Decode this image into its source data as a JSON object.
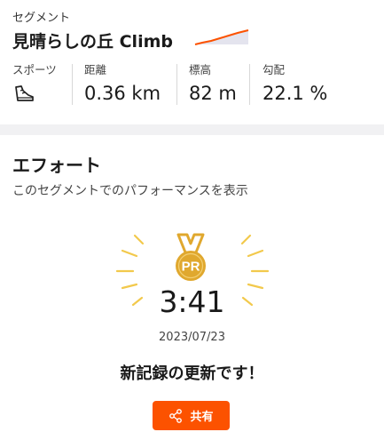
{
  "segment": {
    "section_label": "セグメント",
    "title": "見晴らしの丘 Climb",
    "sparkline_color": "#fc5200"
  },
  "stats": {
    "sport": {
      "label": "スポーツ",
      "icon": "running-shoe-icon"
    },
    "distance": {
      "label": "距離",
      "value": "0.36 km"
    },
    "elevation": {
      "label": "標高",
      "value": "82 m"
    },
    "grade": {
      "label": "勾配",
      "value": "22.1 %"
    }
  },
  "effort": {
    "title": "エフォート",
    "subtitle": "このセグメントでのパフォーマンスを表示",
    "medal_text": "PR",
    "time": "3:41",
    "date": "2023/07/23",
    "message": "新記録の更新です！",
    "share_label": "共有",
    "accent_color": "#fc5200",
    "medal_color": "#e0a82e"
  }
}
